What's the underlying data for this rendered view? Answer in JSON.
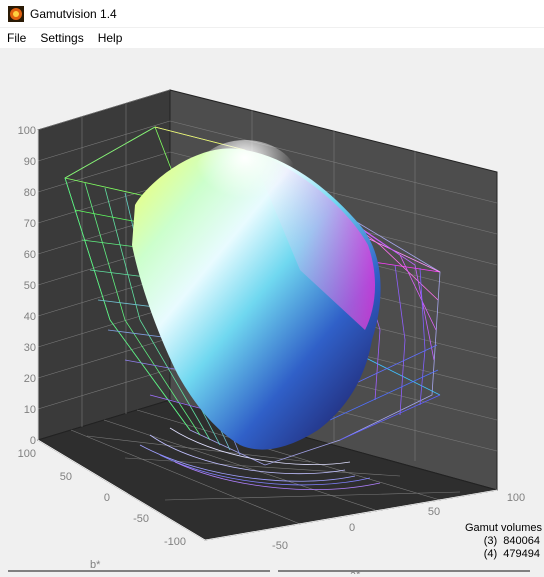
{
  "window": {
    "title": "Gamutvision 1.4",
    "icon": "gamutvision-app-icon"
  },
  "menu": {
    "items": [
      "File",
      "Settings",
      "Help"
    ]
  },
  "plot": {
    "type": "3d-gamut",
    "z_ticks": [
      "100",
      "90",
      "80",
      "70",
      "60",
      "50",
      "40",
      "30",
      "20",
      "10",
      "0"
    ],
    "b_ticks": [
      "100",
      "50",
      "0",
      "-50",
      "-100"
    ],
    "a_ticks": [
      "-50",
      "0",
      "50",
      "100"
    ],
    "b_label": "b*",
    "a_label": "a*",
    "colors": {
      "pane_back": "#4d4d4d",
      "pane_left": "#3a3a3a",
      "pane_floor": "#2e2e2e",
      "grid": "#8a8a8a"
    }
  },
  "gamut_volumes": {
    "title": "Gamut volumes",
    "rows": [
      {
        "id": "(3)",
        "value": "840064"
      },
      {
        "id": "(4)",
        "value": "479494"
      }
    ]
  }
}
